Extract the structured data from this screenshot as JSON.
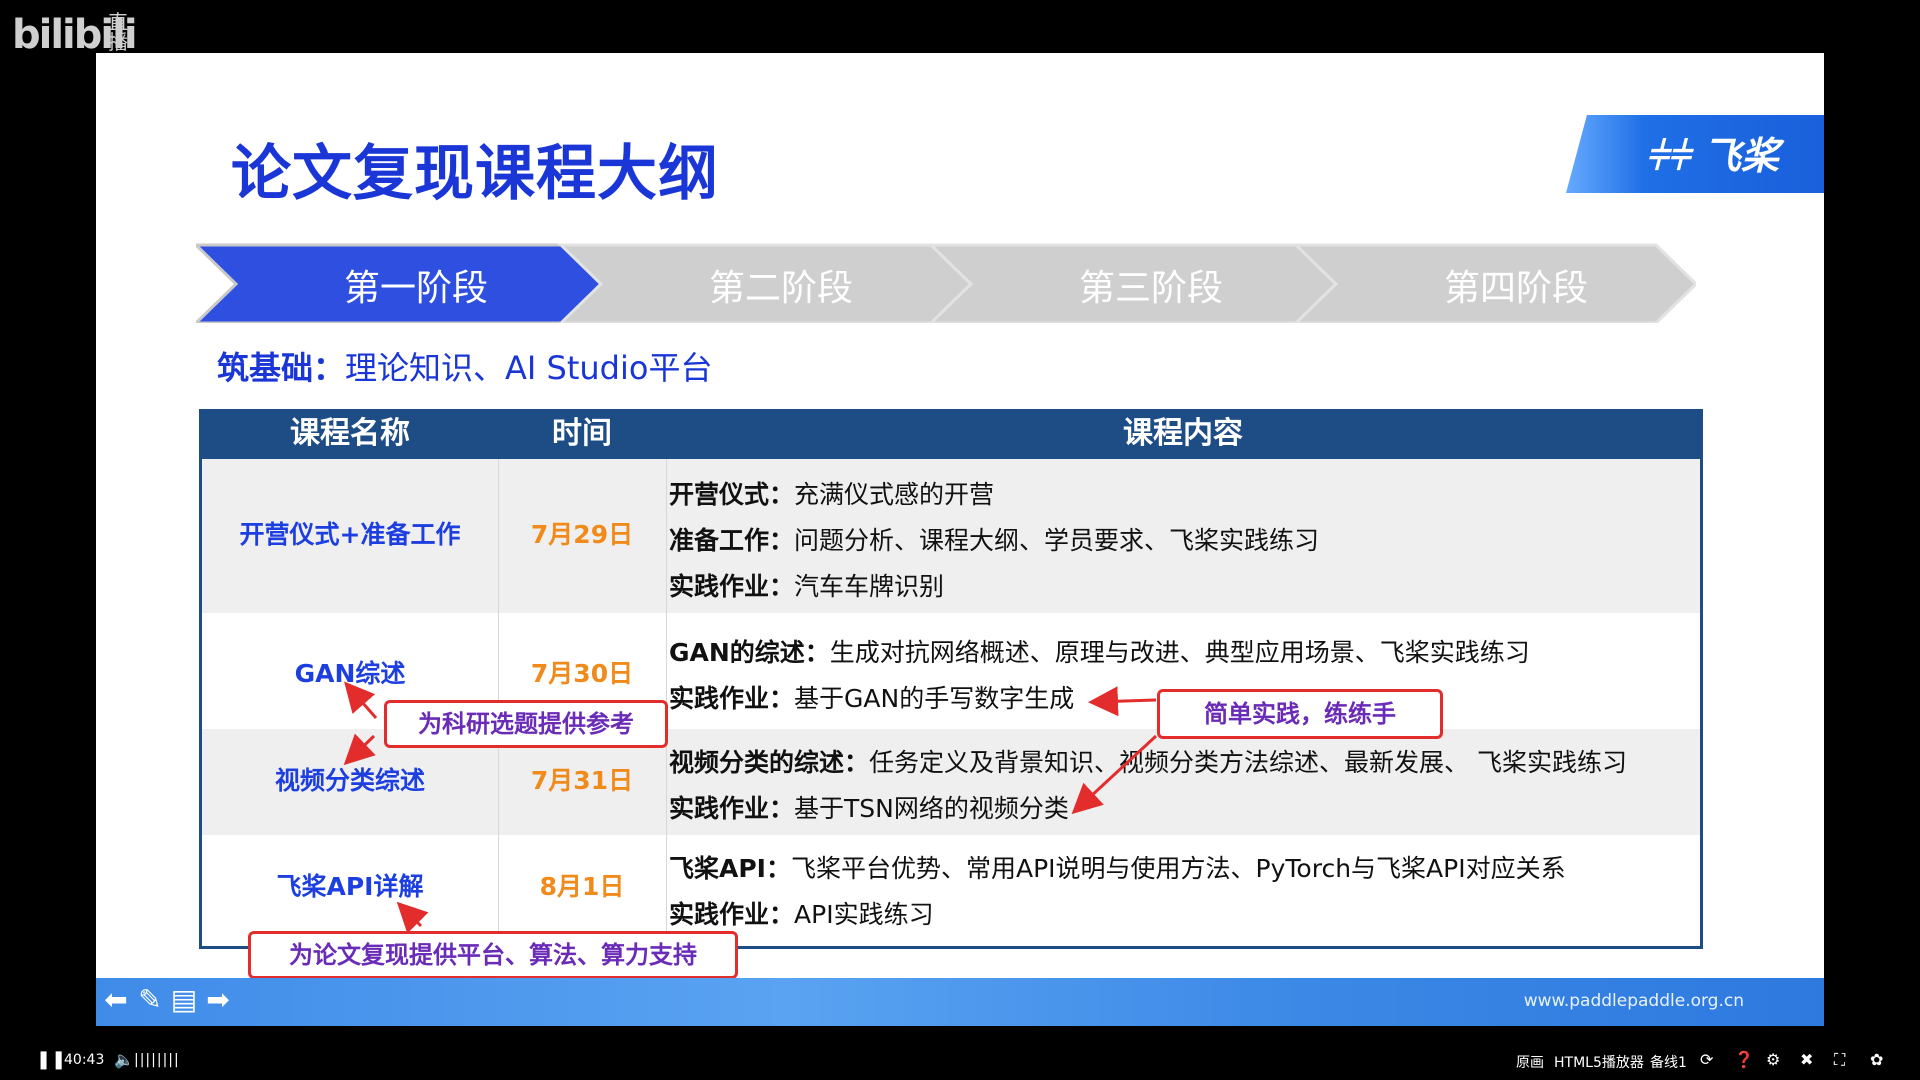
{
  "app": {
    "logo_text": "bilibili",
    "live_label": "直播"
  },
  "slide": {
    "title": "论文复现课程大纲",
    "brand": "飞桨",
    "stages": [
      "第一阶段",
      "第二阶段",
      "第三阶段",
      "第四阶段"
    ],
    "subtitle_bold": "筑基础：",
    "subtitle_rest": "理论知识、AI Studio平台",
    "table": {
      "headers": [
        "课程名称",
        "时间",
        "课程内容"
      ],
      "rows": [
        {
          "name": "开营仪式+准备工作",
          "time": "7月29日",
          "lines": [
            {
              "label": "开营仪式：",
              "text": "充满仪式感的开营"
            },
            {
              "label": "准备工作：",
              "text": "问题分析、课程大纲、学员要求、飞桨实践练习"
            },
            {
              "label": "实践作业：",
              "text": "汽车车牌识别"
            }
          ]
        },
        {
          "name": "GAN综述",
          "time": "7月30日",
          "lines": [
            {
              "label": "GAN的综述：",
              "text": "生成对抗网络概述、原理与改进、典型应用场景、飞桨实践练习"
            },
            {
              "label": "实践作业：",
              "text": "基于GAN的手写数字生成"
            }
          ]
        },
        {
          "name": "视频分类综述",
          "time": "7月31日",
          "lines": [
            {
              "label": "视频分类的综述：",
              "text": "任务定义及背景知识、视频分类方法综述、最新发展、 飞桨实践练习"
            },
            {
              "label": "实践作业：",
              "text": "基于TSN网络的视频分类"
            }
          ]
        },
        {
          "name": "飞桨API详解",
          "time": "8月1日",
          "lines": [
            {
              "label": "飞桨API：",
              "text": "飞桨平台优势、常用API说明与使用方法、PyTorch与飞桨API对应关系"
            },
            {
              "label": "实践作业：",
              "text": "API实践练习"
            }
          ]
        }
      ]
    },
    "callouts": {
      "research": "为科研选题提供参考",
      "practice": "简单实践，练练手",
      "platform": "为论文复现提供平台、算法、算力支持"
    },
    "footer_url": "www.paddlepaddle.org.cn"
  },
  "player": {
    "time": "40:43",
    "quality": "原画",
    "player_name": "HTML5播放器",
    "line": "备线1"
  }
}
